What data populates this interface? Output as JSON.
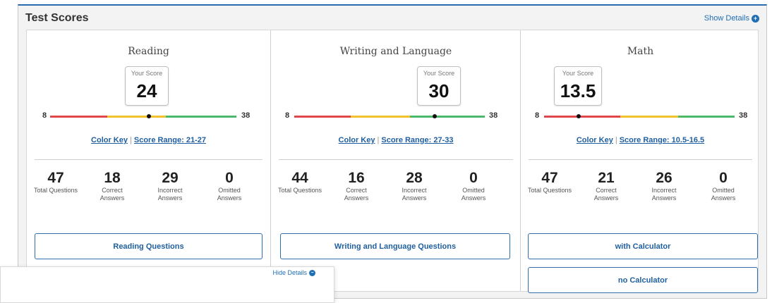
{
  "panel": {
    "title": "Test Scores",
    "show_details": "Show Details"
  },
  "sections": [
    {
      "name": "Reading",
      "score_label": "Your Score",
      "score": "24",
      "scale_min": "8",
      "scale_max": "38",
      "color_key": "Color Key",
      "range_label": "Score Range: 21-27",
      "stats": [
        {
          "value": "47",
          "caption": "Total Questions"
        },
        {
          "value": "18",
          "caption": "Correct Answers"
        },
        {
          "value": "29",
          "caption": "Incorrect Answers"
        },
        {
          "value": "0",
          "caption": "Omitted Answers"
        }
      ],
      "buttons": [
        "Reading Questions"
      ]
    },
    {
      "name": "Writing and Language",
      "score_label": "Your Score",
      "score": "30",
      "scale_min": "8",
      "scale_max": "38",
      "color_key": "Color Key",
      "range_label": "Score Range: 27-33",
      "stats": [
        {
          "value": "44",
          "caption": "Total Questions"
        },
        {
          "value": "16",
          "caption": "Correct Answers"
        },
        {
          "value": "28",
          "caption": "Incorrect Answers"
        },
        {
          "value": "0",
          "caption": "Omitted Answers"
        }
      ],
      "buttons": [
        "Writing and Language Questions"
      ]
    },
    {
      "name": "Math",
      "score_label": "Your Score",
      "score": "13.5",
      "scale_min": "8",
      "scale_max": "38",
      "color_key": "Color Key",
      "range_label": "Score Range: 10.5-16.5",
      "stats": [
        {
          "value": "47",
          "caption": "Total Questions"
        },
        {
          "value": "21",
          "caption": "Correct Answers"
        },
        {
          "value": "26",
          "caption": "Incorrect Answers"
        },
        {
          "value": "0",
          "caption": "Omitted Answers"
        }
      ],
      "buttons": [
        "with Calculator",
        "no Calculator"
      ]
    }
  ],
  "popup": {
    "hide_details": "Hide Details"
  },
  "colors": {
    "accent": "#1f6fb5",
    "red": "#e0474c",
    "yellow": "#f2c12e",
    "green": "#4cb86a"
  }
}
